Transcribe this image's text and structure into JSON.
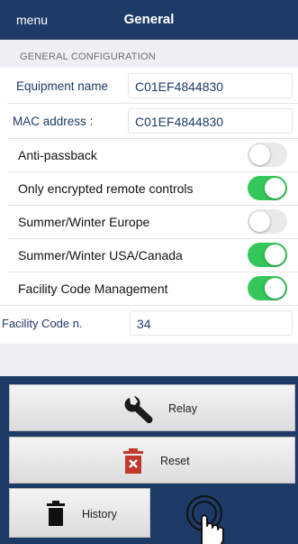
{
  "nav": {
    "menu_label": "menu",
    "title": "General"
  },
  "section": {
    "header": "GENERAL CONFIGURATION"
  },
  "fields": {
    "equipment_name": {
      "label": "Equipment name",
      "value": "C01EF4844830"
    },
    "mac_address": {
      "label": "MAC address :",
      "value": "C01EF4844830"
    },
    "facility_code": {
      "label": "Facility Code n.",
      "value": "34"
    }
  },
  "toggles": [
    {
      "label": "Anti-passback",
      "on": false
    },
    {
      "label": "Only encrypted remote controls",
      "on": true
    },
    {
      "label": "Summer/Winter Europe",
      "on": false
    },
    {
      "label": "Summer/Winter USA/Canada",
      "on": true
    },
    {
      "label": "Facility Code Management",
      "on": true
    }
  ],
  "actions": {
    "relay": "Relay",
    "reset": "Reset",
    "history": "History"
  },
  "icons": [
    "wrench-icon",
    "trash-x-icon",
    "trash-icon",
    "tap-hand-icon"
  ],
  "colors": {
    "nav": "#1e3a66",
    "toggle_on": "#34c759",
    "toggle_off": "#e9e9ea",
    "reset_icon": "#c0392b"
  }
}
